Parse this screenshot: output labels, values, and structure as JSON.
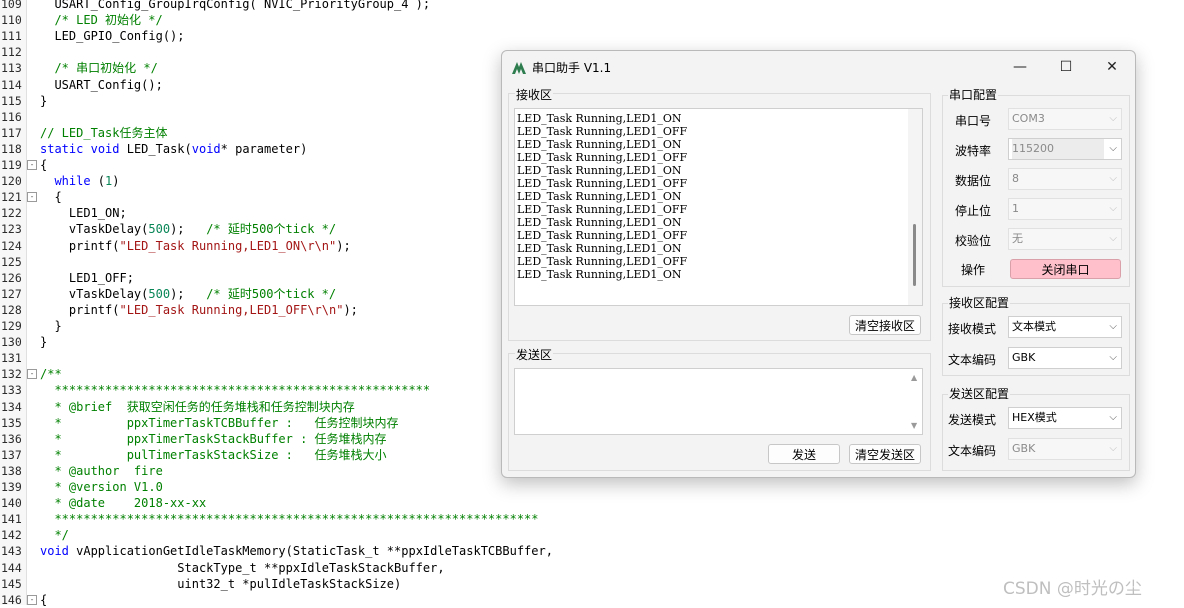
{
  "editor": {
    "lines": [
      {
        "n": "109",
        "fold": "",
        "html": "&nbsp;&nbsp;USART_Config_GroupIrqConfig( NVIC_PriorityGroup_4 );"
      },
      {
        "n": "110",
        "fold": "",
        "html": "&nbsp;&nbsp;<span class='cm'>/* LED 初始化 */</span>"
      },
      {
        "n": "111",
        "fold": "",
        "html": "&nbsp;&nbsp;LED_GPIO_Config();"
      },
      {
        "n": "112",
        "fold": "",
        "html": ""
      },
      {
        "n": "113",
        "fold": "",
        "html": "&nbsp;&nbsp;<span class='cm'>/* 串口初始化 */</span>"
      },
      {
        "n": "114",
        "fold": "",
        "html": "&nbsp;&nbsp;USART_Config();"
      },
      {
        "n": "115",
        "fold": "",
        "html": "}"
      },
      {
        "n": "116",
        "fold": "",
        "html": ""
      },
      {
        "n": "117",
        "fold": "",
        "html": "<span class='cm'>// LED_Task任务主体</span>"
      },
      {
        "n": "118",
        "fold": "",
        "html": "<span class='kw'>static</span> <span class='kw'>void</span> LED_Task(<span class='kw'>void</span>* parameter)"
      },
      {
        "n": "119",
        "fold": "-",
        "html": "{"
      },
      {
        "n": "120",
        "fold": "",
        "html": "&nbsp;&nbsp;<span class='kw'>while</span> (<span class='num'>1</span>)"
      },
      {
        "n": "121",
        "fold": "-",
        "html": "&nbsp;&nbsp;{"
      },
      {
        "n": "122",
        "fold": "",
        "html": "&nbsp;&nbsp;&nbsp;&nbsp;LED1_ON;"
      },
      {
        "n": "123",
        "fold": "",
        "html": "&nbsp;&nbsp;&nbsp;&nbsp;vTaskDelay(<span class='num'>500</span>);&nbsp;&nbsp;&nbsp;<span class='cm'>/* 延时500个tick */</span>"
      },
      {
        "n": "124",
        "fold": "",
        "html": "&nbsp;&nbsp;&nbsp;&nbsp;printf(<span class='str'>\"LED_Task Running,LED1_ON\\r\\n\"</span>);"
      },
      {
        "n": "125",
        "fold": "",
        "html": ""
      },
      {
        "n": "126",
        "fold": "",
        "html": "&nbsp;&nbsp;&nbsp;&nbsp;LED1_OFF;"
      },
      {
        "n": "127",
        "fold": "",
        "html": "&nbsp;&nbsp;&nbsp;&nbsp;vTaskDelay(<span class='num'>500</span>);&nbsp;&nbsp;&nbsp;<span class='cm'>/* 延时500个tick */</span>"
      },
      {
        "n": "128",
        "fold": "",
        "html": "&nbsp;&nbsp;&nbsp;&nbsp;printf(<span class='str'>\"LED_Task Running,LED1_OFF\\r\\n\"</span>);"
      },
      {
        "n": "129",
        "fold": "",
        "html": "&nbsp;&nbsp;}"
      },
      {
        "n": "130",
        "fold": "",
        "html": "}"
      },
      {
        "n": "131",
        "fold": "",
        "html": ""
      },
      {
        "n": "132",
        "fold": "-",
        "html": "<span class='cm'>/**</span>"
      },
      {
        "n": "133",
        "fold": "",
        "html": "<span class='cm'>&nbsp;&nbsp;****************************************************</span>"
      },
      {
        "n": "134",
        "fold": "",
        "html": "<span class='cm'>&nbsp;&nbsp;* @brief&nbsp;&nbsp;获取空闲任务的任务堆栈和任务控制块内存</span>"
      },
      {
        "n": "135",
        "fold": "",
        "html": "<span class='cm'>&nbsp;&nbsp;*&nbsp;&nbsp;&nbsp;&nbsp;&nbsp;&nbsp;&nbsp;&nbsp;&nbsp;ppxTimerTaskTCBBuffer&nbsp;:&nbsp;&nbsp;&nbsp;任务控制块内存</span>"
      },
      {
        "n": "136",
        "fold": "",
        "html": "<span class='cm'>&nbsp;&nbsp;*&nbsp;&nbsp;&nbsp;&nbsp;&nbsp;&nbsp;&nbsp;&nbsp;&nbsp;ppxTimerTaskStackBuffer&nbsp;: 任务堆栈内存</span>"
      },
      {
        "n": "137",
        "fold": "",
        "html": "<span class='cm'>&nbsp;&nbsp;*&nbsp;&nbsp;&nbsp;&nbsp;&nbsp;&nbsp;&nbsp;&nbsp;&nbsp;pulTimerTaskStackSize&nbsp;:&nbsp;&nbsp;&nbsp;任务堆栈大小</span>"
      },
      {
        "n": "138",
        "fold": "",
        "html": "<span class='cm'>&nbsp;&nbsp;* @author&nbsp;&nbsp;fire</span>"
      },
      {
        "n": "139",
        "fold": "",
        "html": "<span class='cm'>&nbsp;&nbsp;* @version V1.0</span>"
      },
      {
        "n": "140",
        "fold": "",
        "html": "<span class='cm'>&nbsp;&nbsp;* @date&nbsp;&nbsp;&nbsp;&nbsp;2018-xx-xx</span>"
      },
      {
        "n": "141",
        "fold": "",
        "html": "<span class='cm'>&nbsp;&nbsp;*******************************************************************</span>"
      },
      {
        "n": "142",
        "fold": "",
        "html": "<span class='cm'>&nbsp;&nbsp;*/</span>"
      },
      {
        "n": "143",
        "fold": "",
        "html": "<span class='kw'>void</span> vApplicationGetIdleTaskMemory(StaticTask_t **ppxIdleTaskTCBBuffer,"
      },
      {
        "n": "144",
        "fold": "",
        "html": "&nbsp;&nbsp;&nbsp;&nbsp;&nbsp;&nbsp;&nbsp;&nbsp;&nbsp;&nbsp;&nbsp;&nbsp;&nbsp;&nbsp;&nbsp;&nbsp;&nbsp;&nbsp;&nbsp;StackType_t **ppxIdleTaskStackBuffer,"
      },
      {
        "n": "145",
        "fold": "",
        "html": "&nbsp;&nbsp;&nbsp;&nbsp;&nbsp;&nbsp;&nbsp;&nbsp;&nbsp;&nbsp;&nbsp;&nbsp;&nbsp;&nbsp;&nbsp;&nbsp;&nbsp;&nbsp;&nbsp;uint32_t *pulIdleTaskStackSize)"
      },
      {
        "n": "146",
        "fold": "-",
        "html": "{"
      }
    ]
  },
  "dialog": {
    "title": "串口助手 V1.1",
    "controls": {
      "minimize": "—",
      "maximize": "☐",
      "close": "✕"
    },
    "receive": {
      "label": "接收区",
      "lines": [
        "LED_Task Running,LED1_ON",
        "LED_Task Running,LED1_OFF",
        "LED_Task Running,LED1_ON",
        "LED_Task Running,LED1_OFF",
        "LED_Task Running,LED1_ON",
        "LED_Task Running,LED1_OFF",
        "LED_Task Running,LED1_ON",
        "LED_Task Running,LED1_OFF",
        "LED_Task Running,LED1_ON",
        "LED_Task Running,LED1_OFF",
        "LED_Task Running,LED1_ON",
        "LED_Task Running,LED1_OFF",
        "LED_Task Running,LED1_ON"
      ],
      "clear_button": "清空接收区"
    },
    "send": {
      "label": "发送区",
      "value": "",
      "send_button": "发送",
      "clear_button": "清空发送区"
    },
    "serial_config": {
      "title": "串口配置",
      "port_label": "串口号",
      "port_value": "COM3",
      "baud_label": "波特率",
      "baud_value": "115200",
      "databits_label": "数据位",
      "databits_value": "8",
      "stopbits_label": "停止位",
      "stopbits_value": "1",
      "parity_label": "校验位",
      "parity_value": "无",
      "action_label": "操作",
      "action_button": "关闭串口",
      "action_color": "#ffc0cb"
    },
    "receive_config": {
      "title": "接收区配置",
      "mode_label": "接收模式",
      "mode_value": "文本模式",
      "encoding_label": "文本编码",
      "encoding_value": "GBK"
    },
    "send_config": {
      "title": "发送区配置",
      "mode_label": "发送模式",
      "mode_value": "HEX模式",
      "encoding_label": "文本编码",
      "encoding_value": "GBK"
    }
  },
  "watermark": "CSDN @时光の尘"
}
